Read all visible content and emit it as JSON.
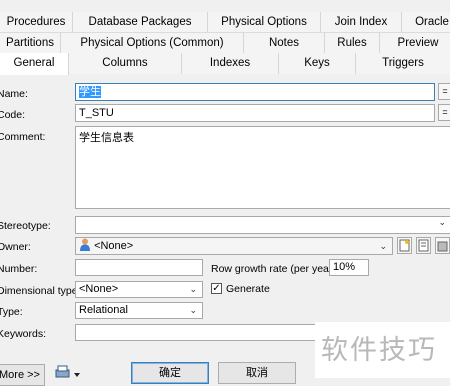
{
  "tabs": {
    "row1": [
      "Procedures",
      "Database Packages",
      "Physical Options",
      "Join Index",
      "Oracle"
    ],
    "row2": [
      "Partitions",
      "Physical Options (Common)",
      "Notes",
      "Rules",
      "Preview"
    ],
    "row3": [
      "General",
      "Columns",
      "Indexes",
      "Keys",
      "Triggers"
    ]
  },
  "form": {
    "name_label": "Name:",
    "name_value": "学生",
    "code_label": "Code:",
    "code_value": "T_STU",
    "comment_label": "Comment:",
    "comment_value": "学生信息表",
    "eq_btn": "=",
    "stereotype_label": "Stereotype:",
    "owner_label": "Owner:",
    "owner_value": "<None>",
    "number_label": "Number:",
    "row_growth_label": "Row growth rate (per year):",
    "row_growth_value": "10%",
    "dimensional_label": "Dimensional type:",
    "dimensional_value": "<None>",
    "generate_label": "Generate",
    "generate_checked": true,
    "type_label": "Type:",
    "type_value": "Relational",
    "keywords_label": "Keywords:"
  },
  "buttons": {
    "more": "More >>",
    "ok": "确定",
    "cancel": "取消"
  },
  "watermark": "软件技巧",
  "icons": {
    "owner": "user-icon",
    "print": "printer-icon",
    "properties": "properties-icon",
    "new": "new-item-icon",
    "browse": "browse-icon"
  }
}
